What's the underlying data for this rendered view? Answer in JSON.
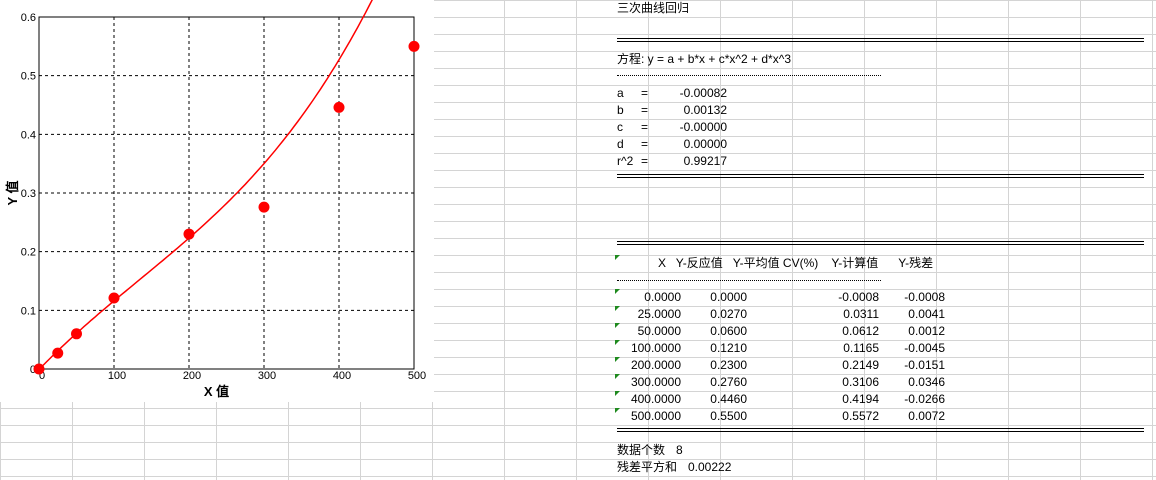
{
  "chart_data": {
    "type": "scatter",
    "xlabel": "X 值",
    "ylabel": "Y 值",
    "xlim": [
      0,
      500
    ],
    "ylim": [
      0,
      0.6
    ],
    "x_ticks": [
      "0",
      "100",
      "200",
      "300",
      "400",
      "500"
    ],
    "y_ticks": [
      "0",
      "0.1",
      "0.2",
      "0.3",
      "0.4",
      "0.5",
      "0.6"
    ],
    "grid": true,
    "series": [
      {
        "points": [
          {
            "x": 0,
            "y": 0.0
          },
          {
            "x": 25,
            "y": 0.027
          },
          {
            "x": 50,
            "y": 0.06
          },
          {
            "x": 100,
            "y": 0.121
          },
          {
            "x": 200,
            "y": 0.23
          },
          {
            "x": 300,
            "y": 0.276
          },
          {
            "x": 400,
            "y": 0.446
          },
          {
            "x": 500,
            "y": 0.55
          }
        ],
        "color": "#ff0000"
      }
    ],
    "fit_curve": {
      "a": -0.00082,
      "b": 0.00132,
      "c": -2e-06,
      "d": 5e-09,
      "color": "#ff0000"
    }
  },
  "report": {
    "title": "三次曲线回归",
    "equation": "方程: y = a + b*x + c*x^2 + d*x^3",
    "coefficients": [
      {
        "name": "a",
        "eq": "=",
        "value": "-0.00082"
      },
      {
        "name": "b",
        "eq": "=",
        "value": "0.00132"
      },
      {
        "name": "c",
        "eq": "=",
        "value": "-0.00000"
      },
      {
        "name": "d",
        "eq": "=",
        "value": "0.00000"
      },
      {
        "name": "r^2",
        "eq": "=",
        "value": "0.99217"
      }
    ],
    "table_header": "X   Y-反应值   Y-平均值 CV(%)    Y-计算值      Y-残差",
    "rows": [
      [
        "0.0000",
        "0.0000",
        "-0.0008",
        "-0.0008"
      ],
      [
        "25.0000",
        "0.0270",
        "0.0311",
        "0.0041"
      ],
      [
        "50.0000",
        "0.0600",
        "0.0612",
        "0.0012"
      ],
      [
        "100.0000",
        "0.1210",
        "0.1165",
        "-0.0045"
      ],
      [
        "200.0000",
        "0.2300",
        "0.2149",
        "-0.0151"
      ],
      [
        "300.0000",
        "0.2760",
        "0.3106",
        "0.0346"
      ],
      [
        "400.0000",
        "0.4460",
        "0.4194",
        "-0.0266"
      ],
      [
        "500.0000",
        "0.5500",
        "0.5572",
        "0.0072"
      ]
    ],
    "count_label": "数据个数",
    "count_value": "8",
    "rss_label": "残差平方和",
    "rss_value": "0.00222"
  }
}
